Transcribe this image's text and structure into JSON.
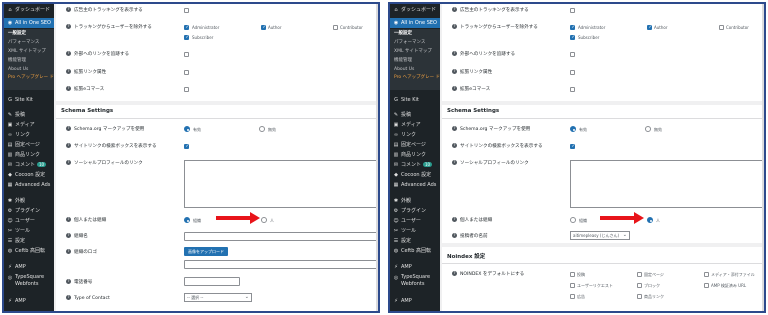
{
  "colors": {
    "accent": "#2271b1",
    "sidebar": "#1d2327",
    "arrow": "#e8141a",
    "frame": "#2d4a8c"
  },
  "sidebar": {
    "items": [
      {
        "icon": "dashboard-icon",
        "glyph": "⌂",
        "label": "ダッシュボード"
      },
      {
        "icon": "aioseo-icon",
        "glyph": "◉",
        "label": "All in One SEO"
      },
      {
        "label": "一般設定"
      },
      {
        "label": "パフォーマンス"
      },
      {
        "label": "XML サイトマップ"
      },
      {
        "label": "機能管理"
      },
      {
        "label": "About Us"
      },
      {
        "label": "Pro へアップグレー ド"
      },
      {
        "icon": "sitekit-icon",
        "glyph": "G",
        "label": "Site Kit"
      },
      {
        "icon": "pin-icon",
        "glyph": "✎",
        "label": "投稿"
      },
      {
        "icon": "media-icon",
        "glyph": "▣",
        "label": "メディア"
      },
      {
        "icon": "link-icon",
        "glyph": "∞",
        "label": "リンク"
      },
      {
        "icon": "page-icon",
        "glyph": "▤",
        "label": "固定ページ"
      },
      {
        "icon": "product-link-icon",
        "glyph": "▥",
        "label": "商品リンク"
      },
      {
        "icon": "comment-icon",
        "glyph": "✉",
        "label": "コメント",
        "badge": "10"
      },
      {
        "icon": "cocoon-icon",
        "glyph": "◆",
        "label": "Cocoon 設定"
      },
      {
        "icon": "ads-icon",
        "glyph": "▦",
        "label": "Advanced Ads"
      },
      {
        "icon": "appearance-icon",
        "glyph": "✱",
        "label": "外観"
      },
      {
        "icon": "plugin-icon",
        "glyph": "⚙",
        "label": "プラグイン"
      },
      {
        "icon": "user-icon",
        "glyph": "☺",
        "label": "ユーザー"
      },
      {
        "icon": "tools-icon",
        "glyph": "✂",
        "label": "ツール"
      },
      {
        "icon": "settings-icon",
        "glyph": "☰",
        "label": "設定"
      },
      {
        "icon": "ceftb-icon",
        "glyph": "◍",
        "label": "Ceftb 高回転"
      },
      {
        "icon": "amp-icon",
        "glyph": "⚡",
        "label": "AMP"
      },
      {
        "icon": "typesquare-icon",
        "glyph": "◎",
        "label": "TypeSquare Webfonts"
      },
      {
        "icon": "amp2-icon",
        "glyph": "⚡",
        "label": "AMP"
      }
    ]
  },
  "top_section": {
    "rows": [
      "広告主のトラッキングを表示する",
      "トラッキングからユーザーを除外する",
      "外部へのリンクを追跡する",
      "拡張リンク属性",
      "拡張eコマース"
    ],
    "roles": [
      "Administrator",
      "Author",
      "Contributor",
      "Subscriber"
    ]
  },
  "schema": {
    "title": "Schema Settings",
    "markup_label": "Schema.org マークアップを使用",
    "on": "有効",
    "off": "無効",
    "sitelinks_label": "サイトリンクの検索ボックスを表示する",
    "social_label": "ソーシャルプロフィールのリンク",
    "person_or_org_label": "個人または組織",
    "org": "組織",
    "person": "人",
    "org_name_label": "組織名",
    "org_logo_label": "組織のロゴ",
    "upload_button": "画像をアップロード",
    "phone_label": "電話番号",
    "contact_type_label": "Type of Contact",
    "contact_type_value": "-- 選択 --",
    "author_name_label": "投稿者の名前",
    "author_select_value": "aitimepleasy (じんさん) "
  },
  "noindex": {
    "title": "Noindex 設定",
    "row_label": "NOINDEX をデフォルトにする",
    "options": [
      "投稿",
      "固定ページ",
      "メディア・添付ファイル",
      "ユーザーリクエスト",
      "ブロック",
      "AMP 検証済み URL",
      "広告",
      "商品リンク"
    ]
  }
}
